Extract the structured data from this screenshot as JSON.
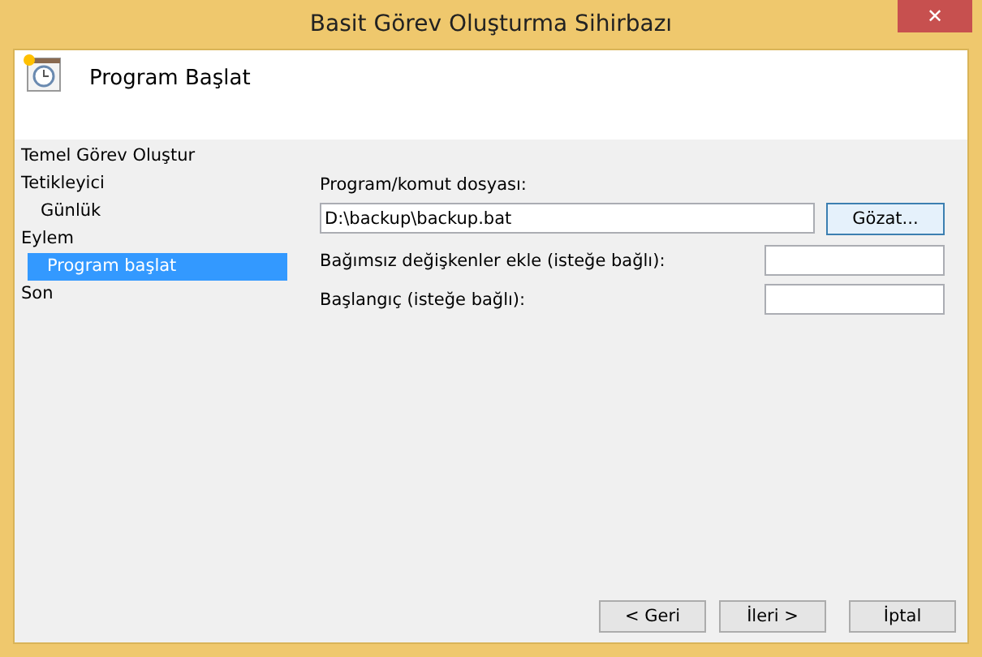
{
  "window": {
    "title": "Basit Görev Oluşturma Sihirbazı",
    "close": "✕"
  },
  "header": {
    "title": "Program Başlat"
  },
  "sidebar": {
    "items": [
      {
        "label": "Temel Görev Oluştur",
        "selected": false
      },
      {
        "label": "Tetikleyici",
        "selected": false,
        "children": [
          {
            "label": "Günlük",
            "selected": false
          }
        ]
      },
      {
        "label": "Eylem",
        "selected": false,
        "children": [
          {
            "label": "Program başlat",
            "selected": true
          }
        ]
      },
      {
        "label": "Son",
        "selected": false
      }
    ]
  },
  "form": {
    "program": {
      "label": "Program/komut dosyası:",
      "value": "D:\\backup\\backup.bat",
      "browse": "Gözat..."
    },
    "arguments": {
      "label": "Bağımsız değişkenler ekle (isteğe bağlı):"
    },
    "start_in": {
      "label": "Başlangıç (isteğe bağlı):"
    }
  },
  "buttons": [
    {
      "label": "< Geri"
    },
    {
      "label": "İleri >"
    },
    {
      "label": "İptal"
    }
  ]
}
